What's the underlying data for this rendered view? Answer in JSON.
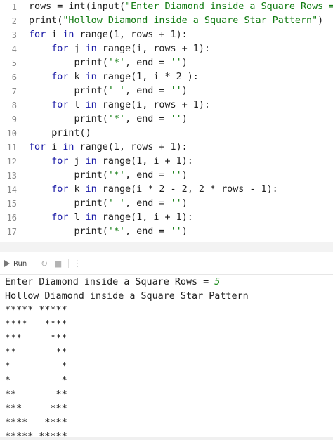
{
  "editor": {
    "lines": [
      {
        "n": "1",
        "html": "rows = int(input(<span class=\"str\">\"Enter Diamond inside a Square Rows = \"</span>))"
      },
      {
        "n": "2",
        "html": "print(<span class=\"str\">\"Hollow Diamond inside a Square Star Pattern\"</span>)"
      },
      {
        "n": "3",
        "html": "<span class=\"kw\">for</span> i <span class=\"kw\">in</span> range(1, rows + 1):"
      },
      {
        "n": "4",
        "html": "    <span class=\"kw\">for</span> j <span class=\"kw\">in</span> range(i, rows + 1):"
      },
      {
        "n": "5",
        "html": "        print(<span class=\"str\">'*'</span>, end = <span class=\"str\">''</span>)"
      },
      {
        "n": "6",
        "html": "    <span class=\"kw\">for</span> k <span class=\"kw\">in</span> range(1, i * 2 ):"
      },
      {
        "n": "7",
        "html": "        print(<span class=\"str\">' '</span>, end = <span class=\"str\">''</span>)"
      },
      {
        "n": "8",
        "html": "    <span class=\"kw\">for</span> l <span class=\"kw\">in</span> range(i, rows + 1):"
      },
      {
        "n": "9",
        "html": "        print(<span class=\"str\">'*'</span>, end = <span class=\"str\">''</span>)"
      },
      {
        "n": "10",
        "html": "    print()"
      },
      {
        "n": "11",
        "html": "<span class=\"kw\">for</span> i <span class=\"kw\">in</span> range(1, rows + 1):"
      },
      {
        "n": "12",
        "html": "    <span class=\"kw\">for</span> j <span class=\"kw\">in</span> range(1, i + 1):"
      },
      {
        "n": "13",
        "html": "        print(<span class=\"str\">'*'</span>, end = <span class=\"str\">''</span>)"
      },
      {
        "n": "14",
        "html": "    <span class=\"kw\">for</span> k <span class=\"kw\">in</span> range(i * 2 - 2, 2 * rows - 1):"
      },
      {
        "n": "15",
        "html": "        print(<span class=\"str\">' '</span>, end = <span class=\"str\">''</span>)"
      },
      {
        "n": "16",
        "html": "    <span class=\"kw\">for</span> l <span class=\"kw\">in</span> range(1, i + 1):"
      },
      {
        "n": "17",
        "html": "        print(<span class=\"str\">'*'</span>, end = <span class=\"str\">''</span>)"
      }
    ]
  },
  "toolbar": {
    "run_label": "Run",
    "icons": [
      "play-icon",
      "rerun-icon",
      "stop-icon",
      "more-vertical-icon"
    ]
  },
  "console": {
    "prompt": "Enter Diamond inside a Square Rows = ",
    "input_value": "5",
    "lines": [
      "Hollow Diamond inside a Square Star Pattern",
      "***** *****",
      "****   ****",
      "***     ***",
      "**       **",
      "*         *",
      "*         *",
      "**       **",
      "***     ***",
      "****   ****",
      "***** *****"
    ]
  },
  "colors": {
    "keyword": "#1a1aa6",
    "string": "#107a10",
    "input_value": "#1a8a1a",
    "line_number": "#8a8a8a"
  }
}
